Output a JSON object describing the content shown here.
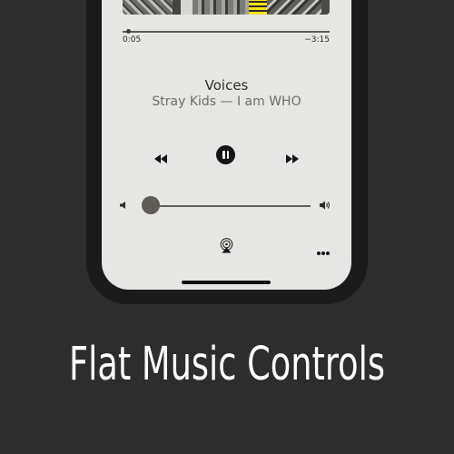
{
  "player": {
    "elapsed": "0:05",
    "remaining": "−3:15",
    "progress": 0.03,
    "song_title": "Voices",
    "artist_album": "Stray Kids — I am WHO",
    "volume": 0.05,
    "state": "playing"
  },
  "icons": {
    "rewind": "rewind-icon",
    "pause": "pause-icon",
    "forward": "fast-forward-icon",
    "volume_low": "speaker-low-icon",
    "volume_high": "speaker-high-icon",
    "airplay": "airplay-icon",
    "more": "more-dots-icon"
  },
  "caption": {
    "text": "Flat Music Controls"
  },
  "colors": {
    "background": "#2d2d2d",
    "screen": "#e6e6e4",
    "accent": "#5e5c54"
  }
}
